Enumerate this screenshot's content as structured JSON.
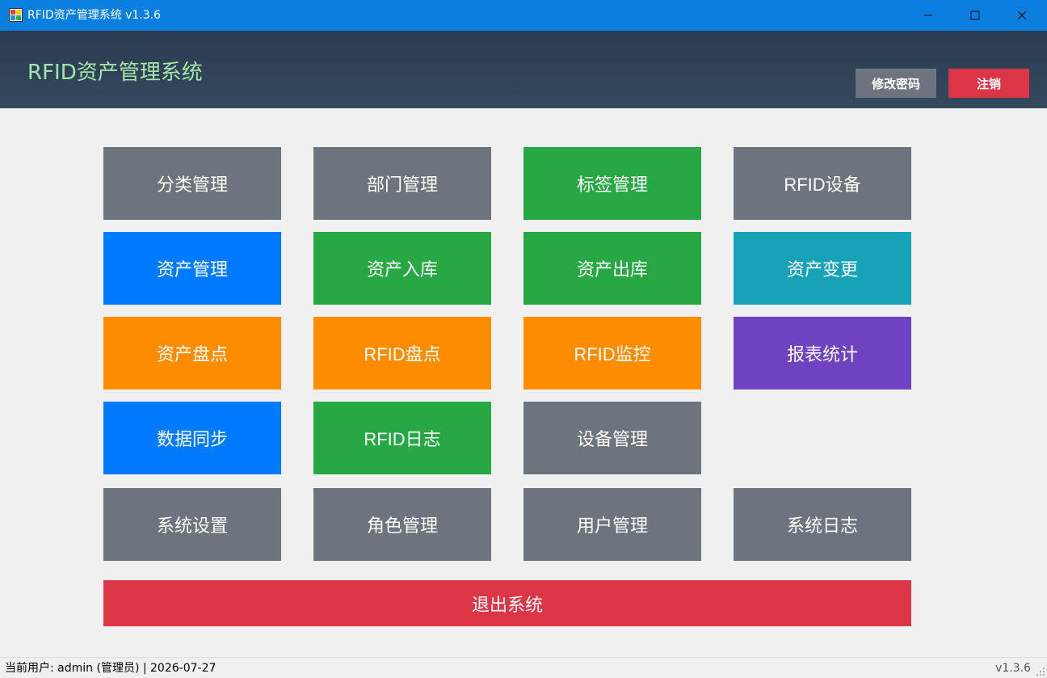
{
  "window": {
    "title": "RFID资产管理系统 v1.3.6",
    "bar_color": "#0a7fe0"
  },
  "header": {
    "title": "RFID资产管理系统",
    "title_color": "#a3e6a8",
    "change_password_label": "修改密码",
    "logout_label": "注销"
  },
  "tiles": [
    {
      "key": "category",
      "label": "分类管理",
      "color": "#6c757d"
    },
    {
      "key": "department",
      "label": "部门管理",
      "color": "#6c757d"
    },
    {
      "key": "tag",
      "label": "标签管理",
      "color": "#28a745"
    },
    {
      "key": "rfid-device",
      "label": "RFID设备",
      "color": "#6c757d"
    },
    {
      "key": "asset",
      "label": "资产管理",
      "color": "#007bff"
    },
    {
      "key": "asset-in",
      "label": "资产入库",
      "color": "#28a745"
    },
    {
      "key": "asset-out",
      "label": "资产出库",
      "color": "#28a745"
    },
    {
      "key": "asset-change",
      "label": "资产变更",
      "color": "#17a2b8"
    },
    {
      "key": "asset-inventory",
      "label": "资产盘点",
      "color": "#fd8c00"
    },
    {
      "key": "rfid-inventory",
      "label": "RFID盘点",
      "color": "#fd8c00"
    },
    {
      "key": "rfid-monitor",
      "label": "RFID监控",
      "color": "#fd8c00"
    },
    {
      "key": "report",
      "label": "报表统计",
      "color": "#6f42c1"
    },
    {
      "key": "data-sync",
      "label": "数据同步",
      "color": "#007bff"
    },
    {
      "key": "rfid-log",
      "label": "RFID日志",
      "color": "#28a745"
    },
    {
      "key": "device",
      "label": "设备管理",
      "color": "#6c757d"
    },
    {
      "key": "settings",
      "label": "系统设置",
      "color": "#6c757d"
    },
    {
      "key": "role",
      "label": "角色管理",
      "color": "#6c757d"
    },
    {
      "key": "user",
      "label": "用户管理",
      "color": "#6c757d"
    },
    {
      "key": "system-log",
      "label": "系统日志",
      "color": "#6c757d"
    }
  ],
  "exit_button": {
    "label": "退出系统",
    "color": "#dc3545"
  },
  "status": {
    "text": "当前用户: admin (管理员) | 2026-07-27",
    "version": "v1.3.6"
  }
}
